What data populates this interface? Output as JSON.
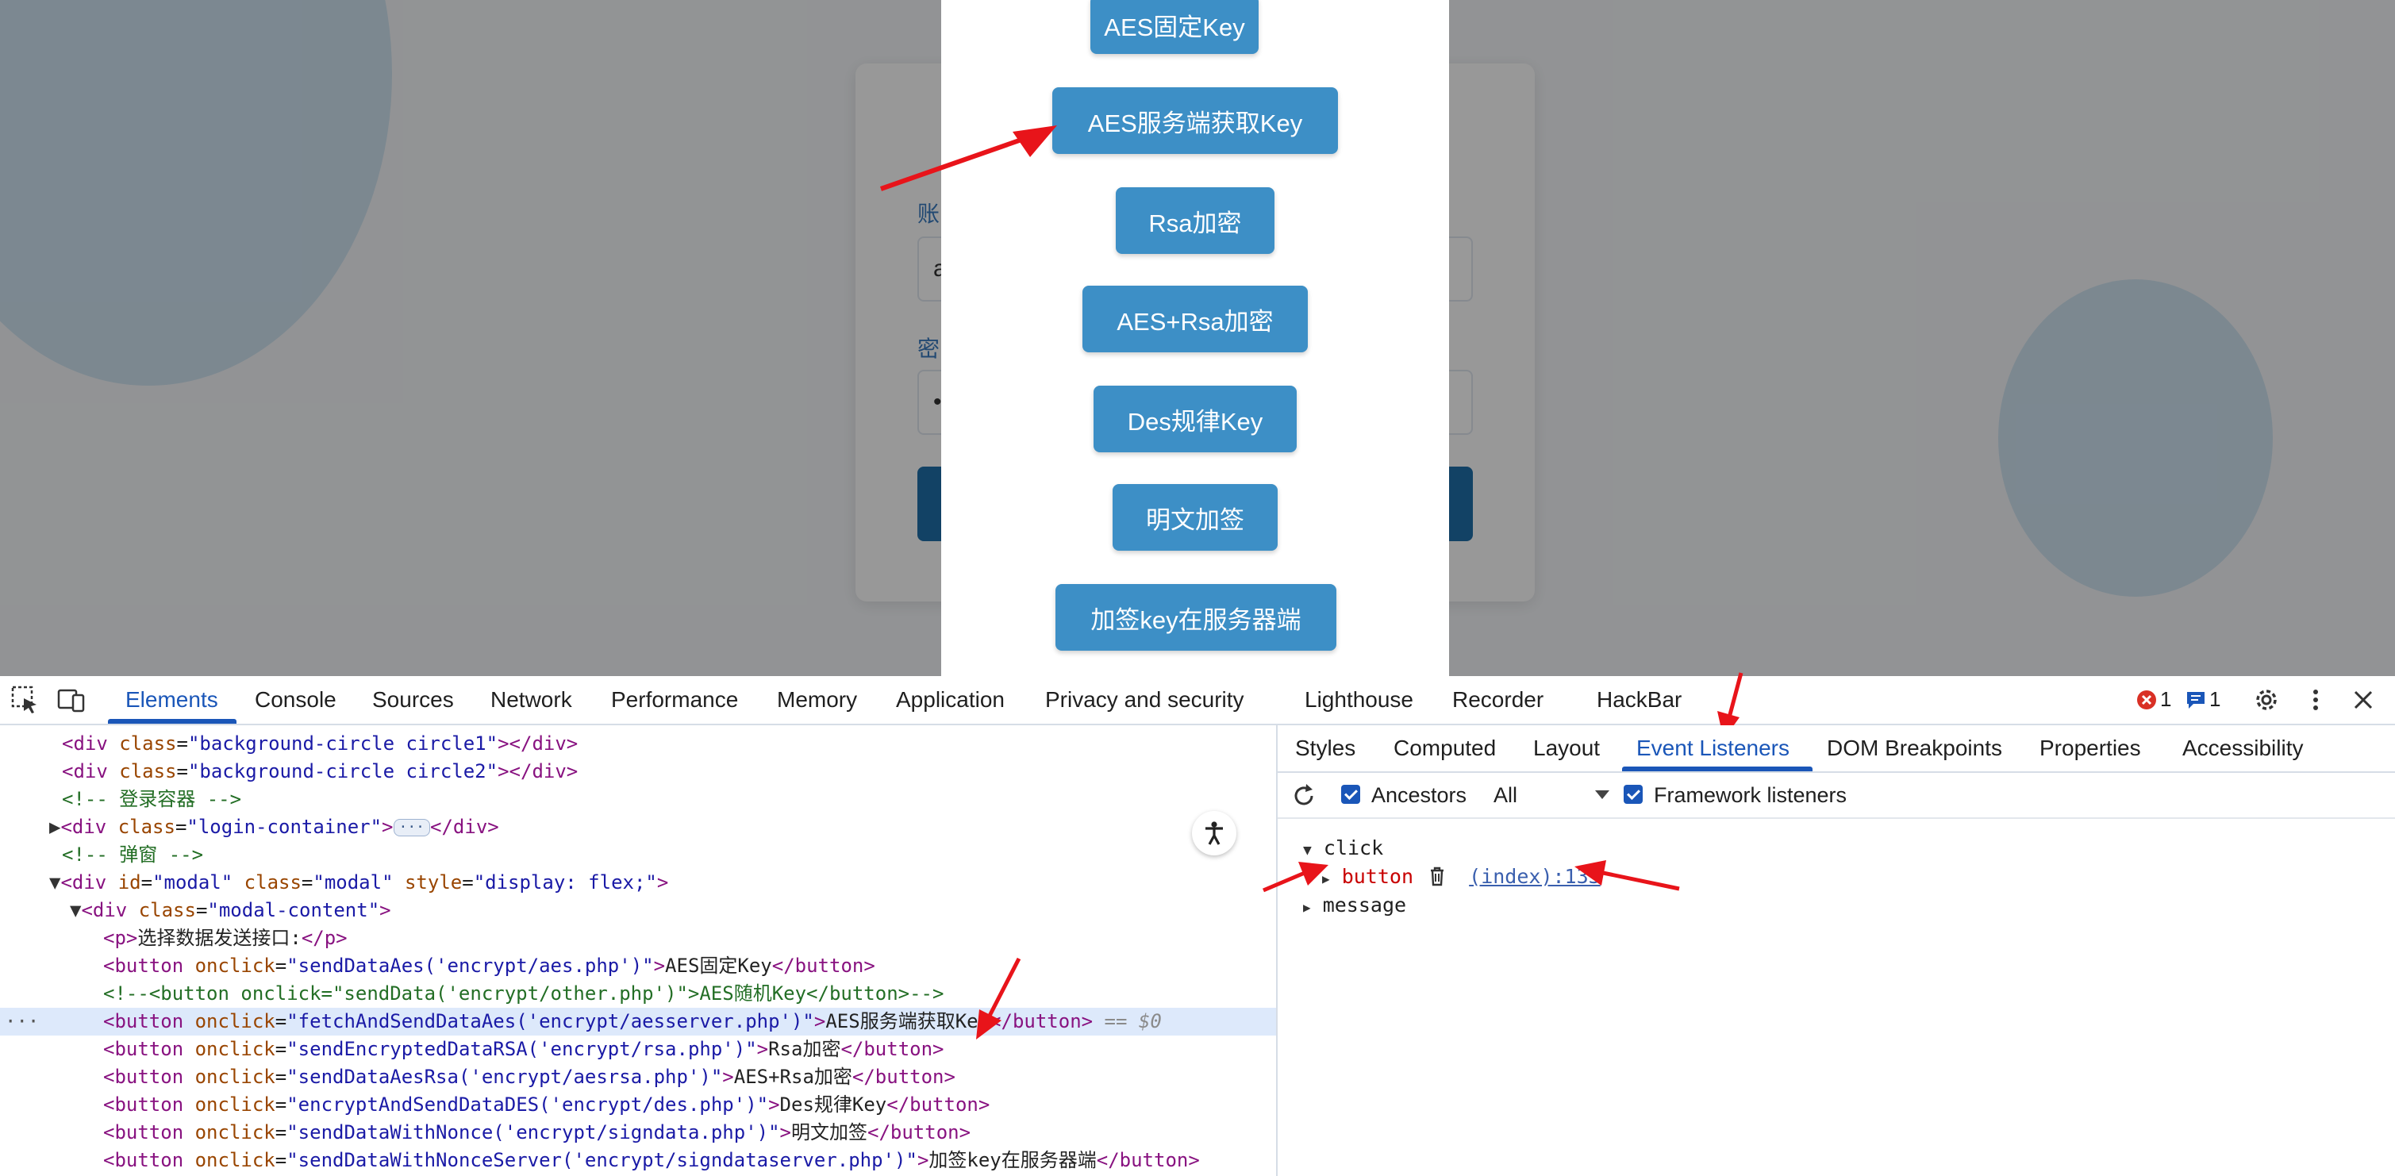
{
  "background_page": {
    "login_labels": {
      "username_partial": "账",
      "password_partial": "密"
    },
    "username_value_partial": "a",
    "password_value_partial": "•"
  },
  "modal": {
    "buttons": [
      "AES固定Key",
      "AES服务端获取Key",
      "Rsa加密",
      "AES+Rsa加密",
      "Des规律Key",
      "明文加签",
      "加签key在服务器端"
    ]
  },
  "devtools": {
    "tabs": [
      "Elements",
      "Console",
      "Sources",
      "Network",
      "Performance",
      "Memory",
      "Application",
      "Privacy and security",
      "Lighthouse",
      "Recorder",
      "HackBar"
    ],
    "active_tab": "Elements",
    "error_count": "1",
    "message_count": "1",
    "dom_lines": [
      {
        "indent": 0,
        "html": "<span class='tag'>&lt;div</span> <span class='attr'>class</span>=<span class='val'>\"background-circle circle1\"</span><span class='tag'>&gt;&lt;/div&gt;</span>"
      },
      {
        "indent": 0,
        "html": "<span class='tag'>&lt;div</span> <span class='attr'>class</span>=<span class='val'>\"background-circle circle2\"</span><span class='tag'>&gt;&lt;/div&gt;</span>"
      },
      {
        "indent": 0,
        "html": "<span class='cmt'>&lt;!-- 登录容器 --&gt;</span>"
      },
      {
        "indent": -1,
        "html": "<span class='tri'>▶</span><span class='tag'>&lt;div</span> <span class='attr'>class</span>=<span class='val'>\"login-container\"</span><span class='tag'>&gt;</span><span class='ellipsis'>···</span><span class='tag'>&lt;/div&gt;</span>"
      },
      {
        "indent": 0,
        "html": "<span class='cmt'>&lt;!-- 弹窗 --&gt;</span>"
      },
      {
        "indent": -1,
        "html": "<span class='tri'>▼</span><span class='tag'>&lt;div</span> <span class='attr'>id</span>=<span class='val'>\"modal\"</span> <span class='attr'>class</span>=<span class='val'>\"modal\"</span> <span class='attr'>style</span>=<span class='val'>\"display: flex;\"</span><span class='tag'>&gt;</span>"
      },
      {
        "indent": 1,
        "html": "<span class='tri'>▼</span><span class='tag'>&lt;div</span> <span class='attr'>class</span>=<span class='val'>\"modal-content\"</span><span class='tag'>&gt;</span>"
      },
      {
        "indent": 3,
        "html": "<span class='tag'>&lt;p&gt;</span><span class='txt'>选择数据发送接口:</span><span class='tag'>&lt;/p&gt;</span>"
      },
      {
        "indent": 3,
        "html": "<span class='tag'>&lt;button</span> <span class='attr'>onclick</span>=<span class='val'>\"sendDataAes('encrypt/aes.php')\"</span><span class='tag'>&gt;</span><span class='txt'>AES固定Key</span><span class='tag'>&lt;/button&gt;</span>"
      },
      {
        "indent": 3,
        "html": "<span class='cmt'>&lt;!--&lt;button onclick=\"sendData('encrypt/other.php')\"&gt;AES随机Key&lt;/button&gt;--&gt;</span>"
      },
      {
        "indent": 3,
        "sel": true,
        "html": "<span class='tag'>&lt;button</span> <span class='attr'>onclick</span>=<span class='val'>\"fetchAndSendDataAes('encrypt/aesserver.php')\"</span><span class='tag'>&gt;</span><span class='txt'>AES服务端获取Key</span><span class='tag'>&lt;/button&gt;</span> <span class='dim'>== $0</span>"
      },
      {
        "indent": 3,
        "html": "<span class='tag'>&lt;button</span> <span class='attr'>onclick</span>=<span class='val'>\"sendEncryptedDataRSA('encrypt/rsa.php')\"</span><span class='tag'>&gt;</span><span class='txt'>Rsa加密</span><span class='tag'>&lt;/button&gt;</span>"
      },
      {
        "indent": 3,
        "html": "<span class='tag'>&lt;button</span> <span class='attr'>onclick</span>=<span class='val'>\"sendDataAesRsa('encrypt/aesrsa.php')\"</span><span class='tag'>&gt;</span><span class='txt'>AES+Rsa加密</span><span class='tag'>&lt;/button&gt;</span>"
      },
      {
        "indent": 3,
        "html": "<span class='tag'>&lt;button</span> <span class='attr'>onclick</span>=<span class='val'>\"encryptAndSendDataDES('encrypt/des.php')\"</span><span class='tag'>&gt;</span><span class='txt'>Des规律Key</span><span class='tag'>&lt;/button&gt;</span>"
      },
      {
        "indent": 3,
        "html": "<span class='tag'>&lt;button</span> <span class='attr'>onclick</span>=<span class='val'>\"sendDataWithNonce('encrypt/signdata.php')\"</span><span class='tag'>&gt;</span><span class='txt'>明文加签</span><span class='tag'>&lt;/button&gt;</span>"
      },
      {
        "indent": 3,
        "html": "<span class='tag'>&lt;button</span> <span class='attr'>onclick</span>=<span class='val'>\"sendDataWithNonceServer('encrypt/signdataserver.php')\"</span><span class='tag'>&gt;</span><span class='txt'>加签key在服务器端</span><span class='tag'>&lt;/button&gt;</span>"
      }
    ],
    "sidebar_tabs": [
      "Styles",
      "Computed",
      "Layout",
      "Event Listeners",
      "DOM Breakpoints",
      "Properties",
      "Accessibility"
    ],
    "active_sidebar_tab": "Event Listeners",
    "toolbar": {
      "ancestors_label": "Ancestors",
      "filter_value": "All",
      "framework_label": "Framework listeners"
    },
    "listeners": {
      "event_click": "click",
      "click_target": "button",
      "click_source": "(index):133",
      "event_message": "message"
    }
  },
  "colors": {
    "modal_button": "#3d8fc6",
    "accent": "#1a56b8",
    "arrow": "#e8141a"
  },
  "icons": [
    "inspect-icon",
    "device-toolbar-icon",
    "error-icon",
    "message-icon",
    "settings-icon",
    "more-icon",
    "close-icon",
    "refresh-icon",
    "trash-icon",
    "accessibility-icon"
  ]
}
